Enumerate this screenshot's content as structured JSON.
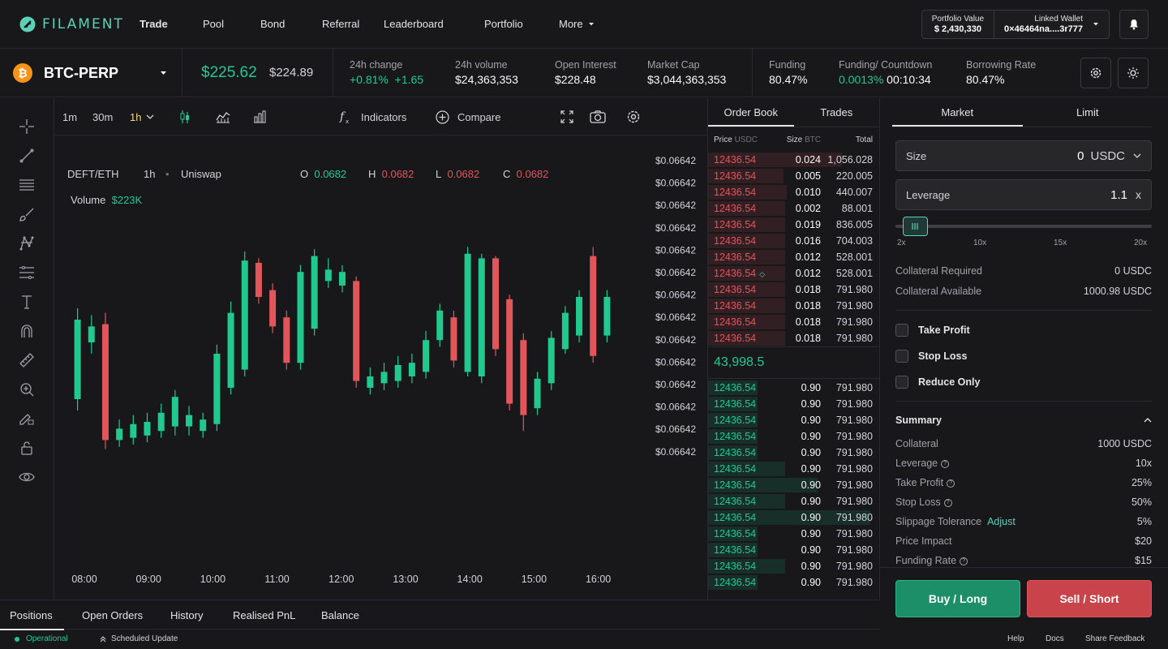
{
  "brand": {
    "name": "FILAMENT"
  },
  "nav": {
    "items": [
      "Trade",
      "Pool",
      "Bond",
      "Referral",
      "Leaderboard",
      "Portfolio",
      "More"
    ],
    "portfolio_value_label": "Portfolio Value",
    "portfolio_value": "$ 2,430,330",
    "wallet_label": "Linked Wallet",
    "wallet_address": "0×46464na....3r777"
  },
  "ticker": {
    "symbol": "BTC-PERP",
    "price": "$225.62",
    "mark_price": "$224.89",
    "change_label": "24h change",
    "change_pct": "+0.81%",
    "change_abs": "+1.65",
    "volume_label": "24h volume",
    "volume": "$24,363,353",
    "oi_label": "Open Interest",
    "oi": "$228.48",
    "mcap_label": "Market Cap",
    "mcap": "$3,044,363,353",
    "funding_label": "Funding",
    "funding": "80.47%",
    "countdown_label": "Funding/ Countdown",
    "countdown_rate": "0.0013%",
    "countdown_time": "00:10:34",
    "borrow_label": "Borrowing Rate",
    "borrow": "80.47%"
  },
  "chart_toolbar": {
    "intervals": [
      "1m",
      "30m",
      "1h"
    ],
    "indicators": "Indicators",
    "compare": "Compare"
  },
  "chart_info": {
    "pair": "DEFT/ETH",
    "interval": "1h",
    "exchange": "Uniswap",
    "o_label": "O",
    "o": "0.0682",
    "h_label": "H",
    "h": "0.0682",
    "l_label": "L",
    "l": "0.0682",
    "c_label": "C",
    "c": "0.0682",
    "volume_label": "Volume",
    "volume": "$223K"
  },
  "chart_data": {
    "type": "candlestick",
    "x_tick_labels": [
      "08:00",
      "09:00",
      "10:00",
      "11:00",
      "12:00",
      "13:00",
      "14:00",
      "15:00",
      "16:00"
    ],
    "y_tick_labels": [
      "$0.06642",
      "$0.06642",
      "$0.06642",
      "$0.06642",
      "$0.06642",
      "$0.06642",
      "$0.06642",
      "$0.06642",
      "$0.06642",
      "$0.06642",
      "$0.06642",
      "$0.06642",
      "$0.06642",
      "$0.06642"
    ],
    "candles": [
      {
        "o": 0.3,
        "c": 0.65,
        "h": 0.7,
        "l": 0.25
      },
      {
        "o": 0.55,
        "c": 0.62,
        "h": 0.67,
        "l": 0.5
      },
      {
        "o": 0.63,
        "c": 0.12,
        "h": 0.68,
        "l": 0.08
      },
      {
        "o": 0.12,
        "c": 0.17,
        "h": 0.21,
        "l": 0.09
      },
      {
        "o": 0.13,
        "c": 0.19,
        "h": 0.23,
        "l": 0.1
      },
      {
        "o": 0.14,
        "c": 0.2,
        "h": 0.24,
        "l": 0.11
      },
      {
        "o": 0.16,
        "c": 0.24,
        "h": 0.28,
        "l": 0.13
      },
      {
        "o": 0.18,
        "c": 0.31,
        "h": 0.34,
        "l": 0.14
      },
      {
        "o": 0.18,
        "c": 0.23,
        "h": 0.27,
        "l": 0.14
      },
      {
        "o": 0.16,
        "c": 0.21,
        "h": 0.24,
        "l": 0.13
      },
      {
        "o": 0.19,
        "c": 0.5,
        "h": 0.54,
        "l": 0.16
      },
      {
        "o": 0.35,
        "c": 0.68,
        "h": 0.73,
        "l": 0.32
      },
      {
        "o": 0.43,
        "c": 0.91,
        "h": 0.95,
        "l": 0.4
      },
      {
        "o": 0.9,
        "c": 0.75,
        "h": 0.92,
        "l": 0.72
      },
      {
        "o": 0.78,
        "c": 0.62,
        "h": 0.81,
        "l": 0.59
      },
      {
        "o": 0.66,
        "c": 0.46,
        "h": 0.69,
        "l": 0.43
      },
      {
        "o": 0.46,
        "c": 0.86,
        "h": 0.89,
        "l": 0.43
      },
      {
        "o": 0.61,
        "c": 0.93,
        "h": 0.96,
        "l": 0.58
      },
      {
        "o": 0.82,
        "c": 0.87,
        "h": 0.92,
        "l": 0.79
      },
      {
        "o": 0.8,
        "c": 0.86,
        "h": 0.89,
        "l": 0.77
      },
      {
        "o": 0.82,
        "c": 0.38,
        "h": 0.84,
        "l": 0.35
      },
      {
        "o": 0.35,
        "c": 0.4,
        "h": 0.44,
        "l": 0.32
      },
      {
        "o": 0.37,
        "c": 0.42,
        "h": 0.46,
        "l": 0.34
      },
      {
        "o": 0.38,
        "c": 0.45,
        "h": 0.49,
        "l": 0.35
      },
      {
        "o": 0.4,
        "c": 0.46,
        "h": 0.5,
        "l": 0.37
      },
      {
        "o": 0.42,
        "c": 0.56,
        "h": 0.6,
        "l": 0.39
      },
      {
        "o": 0.56,
        "c": 0.69,
        "h": 0.72,
        "l": 0.53
      },
      {
        "o": 0.66,
        "c": 0.47,
        "h": 0.69,
        "l": 0.44
      },
      {
        "o": 0.42,
        "c": 0.94,
        "h": 0.97,
        "l": 0.4
      },
      {
        "o": 0.4,
        "c": 0.92,
        "h": 0.94,
        "l": 0.37
      },
      {
        "o": 0.92,
        "c": 0.52,
        "h": 0.93,
        "l": 0.49
      },
      {
        "o": 0.74,
        "c": 0.28,
        "h": 0.76,
        "l": 0.25
      },
      {
        "o": 0.56,
        "c": 0.23,
        "h": 0.59,
        "l": 0.16
      },
      {
        "o": 0.26,
        "c": 0.39,
        "h": 0.42,
        "l": 0.23
      },
      {
        "o": 0.37,
        "c": 0.57,
        "h": 0.6,
        "l": 0.34
      },
      {
        "o": 0.52,
        "c": 0.68,
        "h": 0.71,
        "l": 0.5
      },
      {
        "o": 0.58,
        "c": 0.75,
        "h": 0.78,
        "l": 0.55
      },
      {
        "o": 0.93,
        "c": 0.49,
        "h": 0.97,
        "l": 0.46
      },
      {
        "o": 0.58,
        "c": 0.75,
        "h": 0.78,
        "l": 0.55
      }
    ]
  },
  "orderbook": {
    "tabs": [
      "Order Book",
      "Trades"
    ],
    "headers": {
      "price": "Price",
      "price_unit": "USDC",
      "size": "Size",
      "size_unit": "BTC",
      "total": "Total"
    },
    "asks": [
      {
        "price": "12436.54",
        "size": "0.024",
        "total": "1,056.028",
        "depth": 0.78
      },
      {
        "price": "12436.54",
        "size": "0.005",
        "total": "220.005",
        "depth": 0.44
      },
      {
        "price": "12436.54",
        "size": "0.010",
        "total": "440.007",
        "depth": 0.46
      },
      {
        "price": "12436.54",
        "size": "0.002",
        "total": "88.001",
        "depth": 0.45
      },
      {
        "price": "12436.54",
        "size": "0.019",
        "total": "836.005",
        "depth": 0.45
      },
      {
        "price": "12436.54",
        "size": "0.016",
        "total": "704.003",
        "depth": 0.45
      },
      {
        "price": "12436.54",
        "size": "0.012",
        "total": "528.001",
        "depth": 0.45
      },
      {
        "price": "12436.54",
        "size": "0.012",
        "total": "528.001",
        "depth": 0.45
      },
      {
        "price": "12436.54",
        "size": "0.018",
        "total": "791.980",
        "depth": 0.45
      },
      {
        "price": "12436.54",
        "size": "0.018",
        "total": "791.980",
        "depth": 0.45
      },
      {
        "price": "12436.54",
        "size": "0.018",
        "total": "791.980",
        "depth": 0.45
      },
      {
        "price": "12436.54",
        "size": "0.018",
        "total": "791.980",
        "depth": 0.45
      }
    ],
    "spread": "43,998.5",
    "bids": [
      {
        "price": "12436.54",
        "size": "0.90",
        "total": "791.980",
        "depth": 0.29
      },
      {
        "price": "12436.54",
        "size": "0.90",
        "total": "791.980",
        "depth": 0.29
      },
      {
        "price": "12436.54",
        "size": "0.90",
        "total": "791.980",
        "depth": 0.29
      },
      {
        "price": "12436.54",
        "size": "0.90",
        "total": "791.980",
        "depth": 0.29
      },
      {
        "price": "12436.54",
        "size": "0.90",
        "total": "791.980",
        "depth": 0.29
      },
      {
        "price": "12436.54",
        "size": "0.90",
        "total": "791.980",
        "depth": 0.45
      },
      {
        "price": "12436.54",
        "size": "0.90",
        "total": "791.980",
        "depth": 0.64
      },
      {
        "price": "12436.54",
        "size": "0.90",
        "total": "791.980",
        "depth": 0.45
      },
      {
        "price": "12436.54",
        "size": "0.90",
        "total": "791.980",
        "depth": 0.95
      },
      {
        "price": "12436.54",
        "size": "0.90",
        "total": "791.980",
        "depth": 0.29
      },
      {
        "price": "12436.54",
        "size": "0.90",
        "total": "791.980",
        "depth": 0.29
      },
      {
        "price": "12436.54",
        "size": "0.90",
        "total": "791.980",
        "depth": 0.45
      },
      {
        "price": "12436.54",
        "size": "0.90",
        "total": "791.980",
        "depth": 0.29
      }
    ]
  },
  "trade": {
    "tabs": [
      "Market",
      "Limit"
    ],
    "size_label": "Size",
    "size_value": "0",
    "size_unit": "USDC",
    "leverage_label": "Leverage",
    "leverage_value": "1.1",
    "leverage_unit": "x",
    "slider_ticks": [
      "2x",
      "10x",
      "15x",
      "20x"
    ],
    "slider_level": 0.03,
    "collateral_required_label": "Collateral Required",
    "collateral_required": "0 USDC",
    "collateral_available_label": "Collateral Available",
    "collateral_available": "1000.98 USDC",
    "take_profit": "Take Profit",
    "stop_loss": "Stop Loss",
    "reduce_only": "Reduce Only",
    "summary_title": "Summary",
    "summary": {
      "collateral_label": "Collateral",
      "collateral": "1000 USDC",
      "leverage_label": "Leverage",
      "leverage": "10x",
      "tp_label": "Take Profit",
      "tp": "25%",
      "sl_label": "Stop Loss",
      "sl": "50%",
      "slippage_label": "Slippage Tolerance",
      "adjust": "Adjust",
      "slippage": "5%",
      "impact_label": "Price Impact",
      "impact": "$20",
      "funding_label": "Funding Rate",
      "funding": "$15"
    },
    "buy": "Buy / Long",
    "sell": "Sell / Short"
  },
  "bottom_tabs": [
    "Positions",
    "Open Orders",
    "History",
    "Realised PnL",
    "Balance"
  ],
  "status": {
    "operational": "Operational",
    "scheduled": "Scheduled Update",
    "help": "Help",
    "docs": "Docs",
    "feedback": "Share Feedback"
  },
  "colors": {
    "green": "#22c98e",
    "red": "#e0565b",
    "accent": "#5dd0b8"
  }
}
